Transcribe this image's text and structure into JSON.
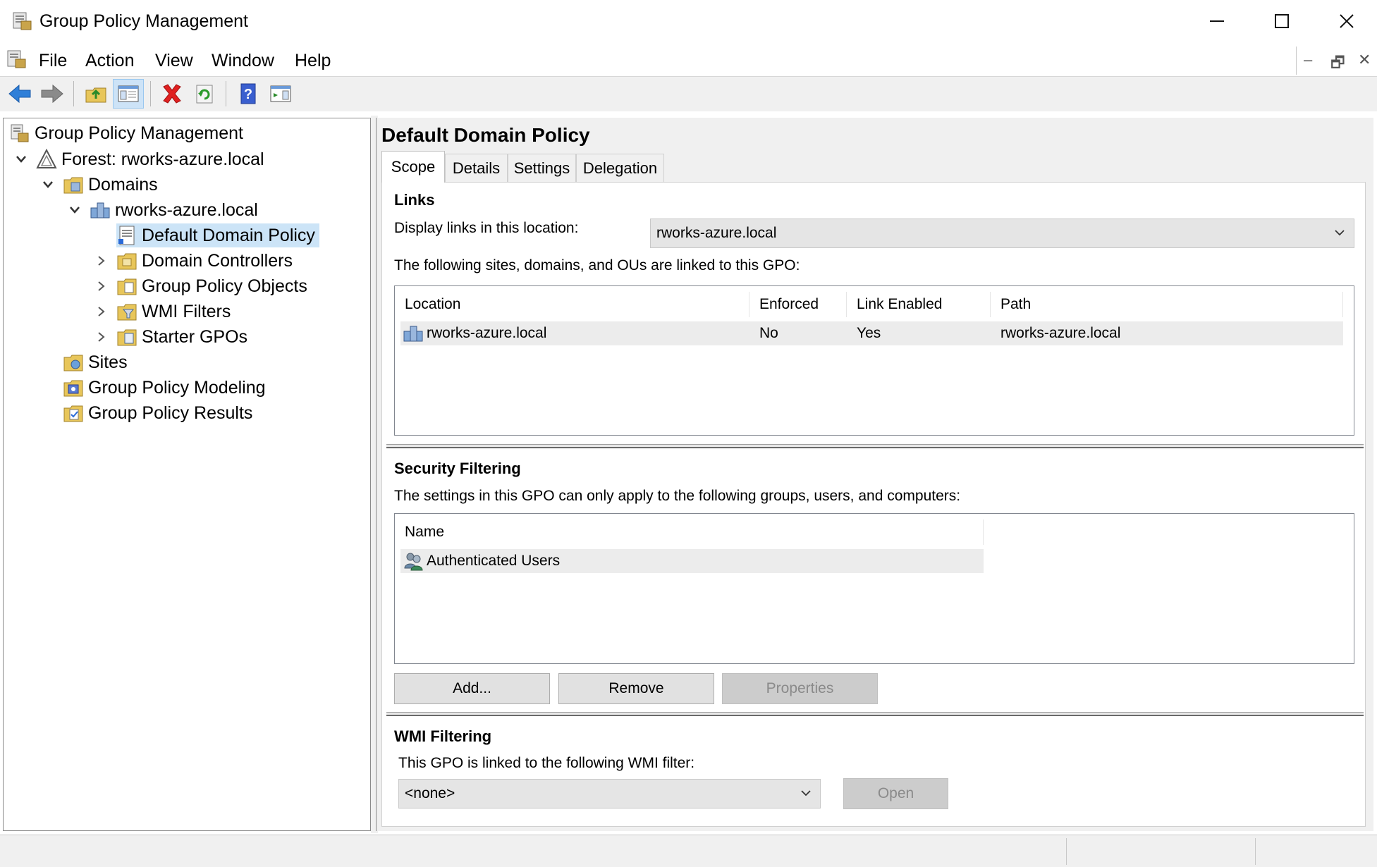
{
  "window": {
    "title": "Group Policy Management",
    "controls": {
      "minimize": "—",
      "maximize": "☐",
      "close": "✕"
    }
  },
  "menu": {
    "items": [
      "File",
      "Action",
      "View",
      "Window",
      "Help"
    ]
  },
  "mdi": {
    "minimize": "–",
    "restore": "🗗",
    "close": "✕"
  },
  "toolbar": {
    "buttons": [
      "back-icon",
      "forward-icon",
      "up-folder-icon",
      "show-hide-console-tree-icon",
      "delete-icon",
      "refresh-icon",
      "help-icon",
      "properties-pane-icon"
    ]
  },
  "tree": {
    "root": "Group Policy Management",
    "forest": "Forest: rworks-azure.local",
    "domains": "Domains",
    "domain": "rworks-azure.local",
    "selected": "Default Domain Policy",
    "domain_children": [
      "Domain Controllers",
      "Group Policy Objects",
      "WMI Filters",
      "Starter GPOs"
    ],
    "others": [
      "Sites",
      "Group Policy Modeling",
      "Group Policy Results"
    ]
  },
  "details": {
    "title": "Default Domain Policy",
    "tabs": [
      "Scope",
      "Details",
      "Settings",
      "Delegation"
    ],
    "active_tab": "Scope",
    "links": {
      "heading": "Links",
      "location_label": "Display links in this location:",
      "location_value": "rworks-azure.local",
      "description": "The following sites, domains, and OUs are linked to this GPO:",
      "columns": [
        "Location",
        "Enforced",
        "Link Enabled",
        "Path"
      ],
      "rows": [
        {
          "location": "rworks-azure.local",
          "enforced": "No",
          "link_enabled": "Yes",
          "path": "rworks-azure.local"
        }
      ]
    },
    "security_filtering": {
      "heading": "Security Filtering",
      "description": "The settings in this GPO can only apply to the following groups, users, and computers:",
      "columns": [
        "Name"
      ],
      "rows": [
        {
          "name": "Authenticated Users"
        }
      ],
      "buttons": {
        "add": "Add...",
        "remove": "Remove",
        "properties": "Properties"
      }
    },
    "wmi_filtering": {
      "heading": "WMI Filtering",
      "description": "This GPO is linked to the following WMI filter:",
      "value": "<none>",
      "open_button": "Open"
    }
  },
  "colors": {
    "selection": "#cce4f7",
    "toolbar_bg": "#f0f0f0",
    "row_highlight": "#ececec",
    "disabled_button": "#cccccc"
  }
}
